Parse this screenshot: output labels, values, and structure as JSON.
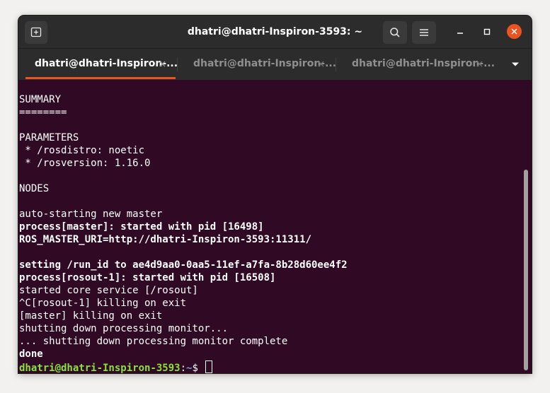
{
  "window": {
    "title": "dhatri@dhatri-Inspiron-3593: ~"
  },
  "tabs": [
    {
      "label": "dhatri@dhatri-Inspiron-...",
      "active": true
    },
    {
      "label": "dhatri@dhatri-Inspiron-...",
      "active": false
    },
    {
      "label": "dhatri@dhatri-Inspiron-...",
      "active": false
    }
  ],
  "colors": {
    "terminal_bg": "#300a24",
    "accent": "#e95420",
    "prompt_user": "#8ae234",
    "prompt_path": "#729fcf"
  },
  "icons": {
    "new_tab": "new-tab-icon",
    "search": "search-icon",
    "menu": "hamburger-menu-icon",
    "minimize": "minimize-icon",
    "maximize": "maximize-icon",
    "close": "close-icon",
    "tab_close": "tab-close-icon",
    "tabs_dropdown": "chevron-down-icon"
  },
  "terminal": {
    "lines": [
      "SUMMARY",
      "========",
      "",
      "PARAMETERS",
      " * /rosdistro: noetic",
      " * /rosversion: 1.16.0",
      "",
      "NODES",
      "",
      "auto-starting new master",
      "process[master]: started with pid [16498]",
      "ROS_MASTER_URI=http://dhatri-Inspiron-3593:11311/",
      "",
      "setting /run_id to ae4d9aa0-0aa5-11ef-a7fa-8b28d60ee4f2",
      "process[rosout-1]: started with pid [16508]",
      "started core service [/rosout]",
      "^C[rosout-1] killing on exit",
      "[master] killing on exit",
      "shutting down processing monitor...",
      "... shutting down processing monitor complete",
      "done"
    ],
    "prompt": {
      "user_host": "dhatri@dhatri-Inspiron-3593",
      "separator": ":",
      "path": "~",
      "symbol": "$ "
    }
  }
}
